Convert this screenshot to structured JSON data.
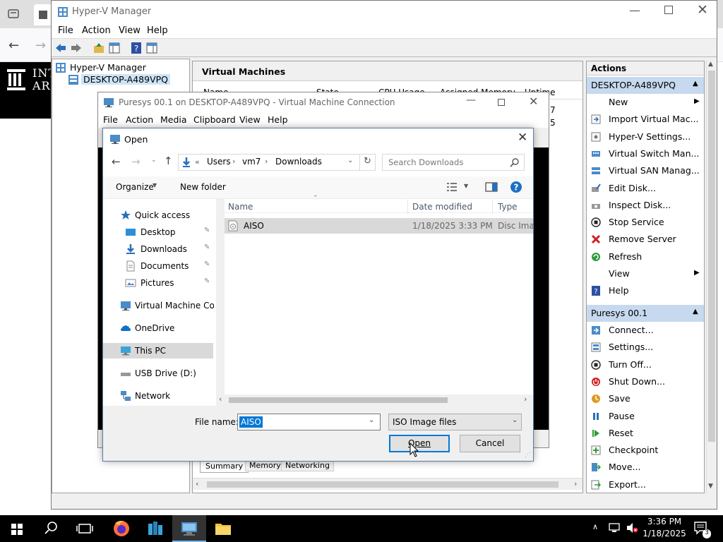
{
  "hyperv": {
    "window_title": "Hyper-V Manager",
    "menu": [
      "File",
      "Action",
      "View",
      "Help"
    ],
    "tree": {
      "root": "Hyper-V Manager",
      "host": "DESKTOP-A489VPQ"
    },
    "center": {
      "header": "Virtual Machines",
      "columns": [
        "Name",
        "State",
        "CPU Usage",
        "Assigned Memory",
        "Uptime"
      ],
      "row_fragments": [
        "7",
        "5"
      ],
      "bottom_tabs": [
        "Summary",
        "Memory",
        "Networking"
      ]
    },
    "actions": {
      "title": "Actions",
      "host_group": "DESKTOP-A489VPQ",
      "host_items": [
        {
          "label": "New",
          "icon": "none",
          "submenu": true
        },
        {
          "label": "Import Virtual Mac...",
          "icon": "import-icon"
        },
        {
          "label": "Hyper-V Settings...",
          "icon": "settings-icon"
        },
        {
          "label": "Virtual Switch Man...",
          "icon": "switch-icon"
        },
        {
          "label": "Virtual SAN Manag...",
          "icon": "san-icon"
        },
        {
          "label": "Edit Disk...",
          "icon": "edit-disk-icon"
        },
        {
          "label": "Inspect Disk...",
          "icon": "inspect-disk-icon"
        },
        {
          "label": "Stop Service",
          "icon": "stop-icon"
        },
        {
          "label": "Remove Server",
          "icon": "remove-icon"
        },
        {
          "label": "Refresh",
          "icon": "refresh-icon"
        },
        {
          "label": "View",
          "icon": "none",
          "submenu": true
        },
        {
          "label": "Help",
          "icon": "help-icon"
        }
      ],
      "vm_group": "Puresys 00.1",
      "vm_items": [
        {
          "label": "Connect...",
          "icon": "connect-icon"
        },
        {
          "label": "Settings...",
          "icon": "vm-settings-icon"
        },
        {
          "label": "Turn Off...",
          "icon": "turn-off-icon"
        },
        {
          "label": "Shut Down...",
          "icon": "shutdown-icon"
        },
        {
          "label": "Save",
          "icon": "save-icon"
        },
        {
          "label": "Pause",
          "icon": "pause-icon"
        },
        {
          "label": "Reset",
          "icon": "reset-icon"
        },
        {
          "label": "Checkpoint",
          "icon": "checkpoint-icon"
        },
        {
          "label": "Move...",
          "icon": "move-icon"
        },
        {
          "label": "Export...",
          "icon": "export-icon"
        }
      ]
    }
  },
  "vm_connection": {
    "title": "Puresys 00.1 on DESKTOP-A489VPQ - Virtual Machine Connection",
    "menu": [
      "File",
      "Action",
      "Media",
      "Clipboard",
      "View",
      "Help"
    ]
  },
  "open_dialog": {
    "title": "Open",
    "breadcrumb": {
      "prefix": "«",
      "parts": [
        "Users",
        "vm7",
        "Downloads"
      ]
    },
    "search_placeholder": "Search Downloads",
    "organize_label": "Organize",
    "new_folder_label": "New folder",
    "columns": [
      "Name",
      "Date modified",
      "Type"
    ],
    "nav_items": [
      {
        "label": "Quick access",
        "icon": "star-icon",
        "indent": 0
      },
      {
        "label": "Desktop",
        "icon": "desktop-folder-icon",
        "indent": 1,
        "pinned": true
      },
      {
        "label": "Downloads",
        "icon": "download-folder-icon",
        "indent": 1,
        "pinned": true
      },
      {
        "label": "Documents",
        "icon": "documents-icon",
        "indent": 1,
        "pinned": true
      },
      {
        "label": "Pictures",
        "icon": "pictures-icon",
        "indent": 1,
        "pinned": true
      },
      {
        "label": "Virtual Machine Conn",
        "icon": "vm-connection-icon",
        "indent": 0
      },
      {
        "label": "OneDrive",
        "icon": "onedrive-icon",
        "indent": 0
      },
      {
        "label": "This PC",
        "icon": "this-pc-icon",
        "indent": 0,
        "selected": true
      },
      {
        "label": "USB Drive (D:)",
        "icon": "usb-drive-icon",
        "indent": 0
      },
      {
        "label": "Network",
        "icon": "network-icon",
        "indent": 0
      }
    ],
    "files": [
      {
        "name": "AISO",
        "date": "1/18/2025 3:33 PM",
        "type": "Disc Imag"
      }
    ],
    "file_name_label": "File name:",
    "file_name_value": "AISO",
    "file_type_value": "ISO Image files",
    "open_label": "Open",
    "cancel_label": "Cancel"
  },
  "taskbar": {
    "time": "3:36 PM",
    "date": "1/18/2025",
    "notification_count": "3"
  },
  "background": {
    "banner_text": [
      "INT",
      "ARC"
    ]
  }
}
